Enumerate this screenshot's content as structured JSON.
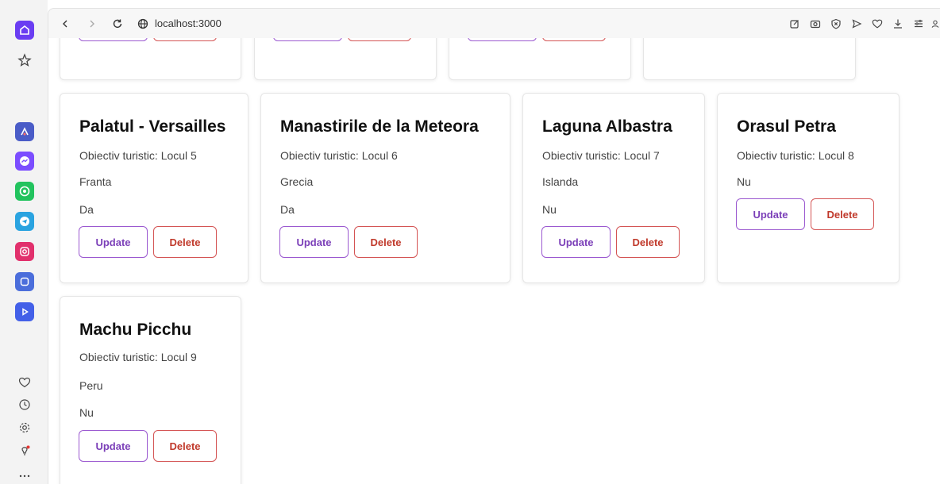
{
  "browser": {
    "url": "localhost:3000"
  },
  "cards": [
    {
      "title": "Palatul - Versailles",
      "subtitle": "Obiectiv turistic: Locul 5",
      "country": "Franta",
      "status": "Da",
      "update": "Update",
      "delete": "Delete"
    },
    {
      "title": "Manastirile de la Meteora",
      "subtitle": "Obiectiv turistic: Locul 6",
      "country": "Grecia",
      "status": "Da",
      "update": "Update",
      "delete": "Delete"
    },
    {
      "title": "Laguna Albastra",
      "subtitle": "Obiectiv turistic: Locul 7",
      "country": "Islanda",
      "status": "Nu",
      "update": "Update",
      "delete": "Delete"
    },
    {
      "title": "Orasul Petra",
      "subtitle": "Obiectiv turistic: Locul 8",
      "status": "Nu",
      "update": "Update",
      "delete": "Delete"
    },
    {
      "title": "Machu Picchu",
      "subtitle": "Obiectiv turistic: Locul 9",
      "country": "Peru",
      "status": "Nu",
      "update": "Update",
      "delete": "Delete"
    }
  ],
  "colors": {
    "update_border": "#9b59d0",
    "delete_border": "#d45454"
  }
}
